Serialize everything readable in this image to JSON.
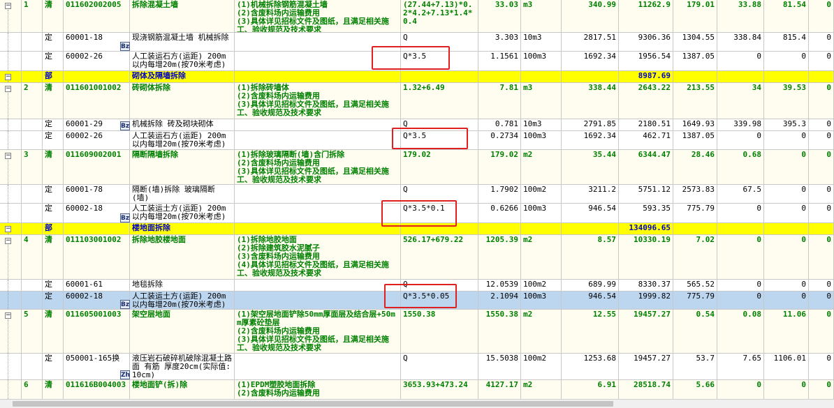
{
  "rows": [
    {
      "kind": "qd",
      "tree": "⊟",
      "cells": [
        "1",
        "清",
        "011602002005",
        "拆除混凝土墙",
        "(1)机械拆除钢筋混凝土墙\n(2)含废料场内运输费用\n(3)具体详见招标文件及图纸，且满足相关施工、验收规范及技术要求",
        "(27.44+7.13)*0.2*4.2+7.13*1.4*0.4",
        "33.03",
        "m3",
        "340.99",
        "11262.9",
        "179.01",
        "33.88",
        "81.54",
        "0"
      ]
    },
    {
      "kind": "de",
      "tree": "",
      "icon": "Bz",
      "cells": [
        "",
        "定",
        "60001-18",
        "现浇钢筋混凝土墙 机械拆除",
        "",
        "Q",
        "3.303",
        "10m3",
        "2817.51",
        "9306.36",
        "1304.55",
        "338.84",
        "815.4",
        "0"
      ]
    },
    {
      "kind": "de",
      "tree": "",
      "cells": [
        "",
        "定",
        "60002-26",
        "人工装运石方(运距) 200m以内每增20m(按70米考虑)",
        "",
        "Q*3.5",
        "1.1561",
        "100m3",
        "1692.34",
        "1956.54",
        "1387.05",
        "0",
        "0",
        "0"
      ]
    },
    {
      "kind": "bu",
      "tree": "⊟",
      "cells": [
        "",
        "部",
        "",
        "砌体及隔墙拆除",
        "",
        "",
        "",
        "",
        "",
        "8987.69",
        "",
        "",
        "",
        ""
      ]
    },
    {
      "kind": "qd",
      "tree": "⊟",
      "cells": [
        "2",
        "清",
        "011601001002",
        "砖砌体拆除",
        "(1)拆除砖墙体\n(2)含废料场内运输费用\n(3)具体详见招标文件及图纸，且满足相关施工、验收规范及技术要求",
        "1.32+6.49",
        "7.81",
        "m3",
        "338.44",
        "2643.22",
        "213.55",
        "34",
        "39.53",
        "0"
      ]
    },
    {
      "kind": "de",
      "tree": "",
      "icon": "Bz",
      "cells": [
        "",
        "定",
        "60001-29",
        "机械拆除 砖及砌块砌体",
        "",
        "Q",
        "0.781",
        "10m3",
        "2791.85",
        "2180.51",
        "1649.93",
        "339.98",
        "395.3",
        "0"
      ]
    },
    {
      "kind": "de",
      "tree": "",
      "cells": [
        "",
        "定",
        "60002-26",
        "人工装运石方(运距) 200m以内每增20m(按70米考虑)",
        "",
        "Q*3.5",
        "0.2734",
        "100m3",
        "1692.34",
        "462.71",
        "1387.05",
        "0",
        "0",
        "0"
      ]
    },
    {
      "kind": "qd",
      "tree": "⊟",
      "cells": [
        "3",
        "清",
        "011609002001",
        "隔断隔墙拆除",
        "(1)拆除玻璃隔断(墙)含门拆除\n(2)含废料场内运输费用\n(3)具体详见招标文件及图纸，且满足相关施工、验收规范及技术要求",
        "179.02",
        "179.02",
        "m2",
        "35.44",
        "6344.47",
        "28.46",
        "0.68",
        "0",
        "0"
      ]
    },
    {
      "kind": "de",
      "tree": "",
      "cells": [
        "",
        "定",
        "60001-78",
        "隔断(墙)拆除 玻璃隔断(墙)",
        "",
        "Q",
        "1.7902",
        "100m2",
        "3211.2",
        "5751.12",
        "2573.83",
        "67.5",
        "0",
        "0"
      ]
    },
    {
      "kind": "de",
      "tree": "",
      "icon": "Bz",
      "cells": [
        "",
        "定",
        "60002-18",
        "人工装运土方(运距) 200m以内每增20m(按70米考虑)",
        "",
        "Q*3.5*0.1",
        "0.6266",
        "100m3",
        "946.54",
        "593.35",
        "775.79",
        "0",
        "0",
        "0"
      ]
    },
    {
      "kind": "bu",
      "tree": "⊟",
      "cells": [
        "",
        "部",
        "",
        "楼地面拆除",
        "",
        "",
        "",
        "",
        "",
        "134096.65",
        "",
        "",
        "",
        ""
      ]
    },
    {
      "kind": "qd",
      "tree": "⊟",
      "cells": [
        "4",
        "清",
        "011103001002",
        "拆除地胶楼地面",
        "(1)拆除地胶地面\n(2)拆除建筑胶水泥腻子\n(3)含废料场内运输费用\n(4)具体详见招标文件及图纸，且满足相关施工、验收规范及技术要求",
        "526.17+679.22",
        "1205.39",
        "m2",
        "8.57",
        "10330.19",
        "7.02",
        "0",
        "0",
        "0"
      ]
    },
    {
      "kind": "de",
      "tree": "",
      "cells": [
        "",
        "定",
        "60001-61",
        "地毯拆除",
        "",
        "Q",
        "12.0539",
        "100m2",
        "689.99",
        "8330.37",
        "565.52",
        "0",
        "0",
        "0"
      ]
    },
    {
      "kind": "sel",
      "tree": "",
      "icon": "Bz",
      "cells": [
        "",
        "定",
        "60002-18",
        "人工装运土方(运距) 200m以内每增20m(按70米考虑)",
        "",
        "Q*3.5*0.05",
        "2.1094",
        "100m3",
        "946.54",
        "1999.82",
        "775.79",
        "0",
        "0",
        "0"
      ]
    },
    {
      "kind": "qd",
      "tree": "⊟",
      "cells": [
        "5",
        "清",
        "011605001003",
        "架空层地面",
        "(1)架空层地面铲除50mm厚面层及结合层+50mm厚素砼垫层\n(2)含废料场内运输费用\n(3)具体详见招标文件及图纸，且满足相关施工、验收规范及技术要求",
        "1550.38",
        "1550.38",
        "m2",
        "12.55",
        "19457.27",
        "0.54",
        "0.08",
        "11.06",
        "0"
      ]
    },
    {
      "kind": "de",
      "tree": "",
      "icon": "Zh",
      "cells": [
        "",
        "定",
        "050001-165换",
        "液压岩石破碎机破除混凝土路面 有筋 厚度20cm(实际值:10cm)",
        "",
        "Q",
        "15.5038",
        "100m2",
        "1253.68",
        "19457.27",
        "53.7",
        "7.65",
        "1106.01",
        "0"
      ]
    },
    {
      "kind": "qd",
      "tree": "",
      "cells": [
        "6",
        "清",
        "011616B004003",
        "楼地面铲(拆)除",
        "(1)EPDM塑胶地面拆除\n(2)含废料场内运输费用",
        "3653.93+473.24",
        "4127.17",
        "m2",
        "6.91",
        "28518.74",
        "5.66",
        "0",
        "0",
        "0"
      ]
    }
  ],
  "colors": {
    "qd_text": "#008000",
    "bu_bg": "#ffff00",
    "bu_text": "#0000cc",
    "selected_bg": "#bcd6f0",
    "highlight": "#e02020"
  },
  "icons": {
    "Bz": "standard-rate-icon",
    "Zh": "converted-rate-icon"
  }
}
